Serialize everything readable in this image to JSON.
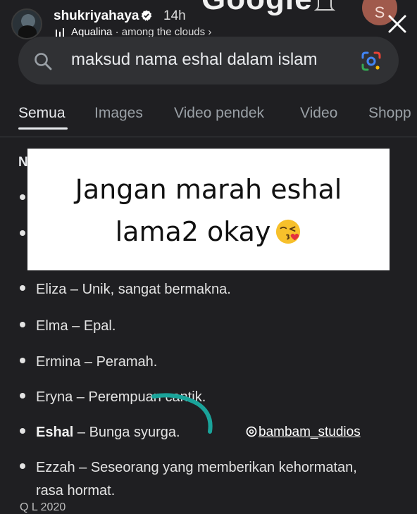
{
  "story": {
    "username": "shukriyahaya",
    "time_ago": "14h",
    "music_artist": "Aqualina",
    "music_separator": "·",
    "music_song": "among the clouds",
    "music_chevron": "›"
  },
  "background_app": {
    "google_logo_partial": "Google",
    "account_initial": "S"
  },
  "search": {
    "query": "maksud nama eshal dalam islam"
  },
  "tabs": [
    {
      "label": "Semua",
      "active": true
    },
    {
      "label": "Images",
      "active": false
    },
    {
      "label": "Video pendek",
      "active": false
    },
    {
      "label": "Video",
      "active": false
    },
    {
      "label": "Shopp",
      "active": false
    }
  ],
  "partial_heading": "N",
  "caption": {
    "line1": "Jangan marah eshal",
    "line2": "lama2 okay"
  },
  "list": [
    {
      "name": "Eliza",
      "meaning": " – Unik, sangat bermakna.",
      "bold": false
    },
    {
      "name": "Elma",
      "meaning": " – Epal.",
      "bold": false
    },
    {
      "name": "Ermina",
      "meaning": " – Peramah.",
      "bold": false
    },
    {
      "name": "Eryna",
      "meaning": " – Perempuan cantik.",
      "bold": false
    },
    {
      "name": "Eshal",
      "meaning": " – Bunga syurga.",
      "bold": true
    },
    {
      "name": "Ezzah",
      "meaning": " – Seseorang yang memberikan kehormatan,",
      "bold": false
    }
  ],
  "list_continuation": "rasa hormat.",
  "watermark": "bambam_studios",
  "cutoff_line": "Q  L  2020",
  "colors": {
    "background": "#1f1f22",
    "search_bar": "#303134",
    "doodle": "#1aa39a",
    "card": "#ffffff"
  }
}
